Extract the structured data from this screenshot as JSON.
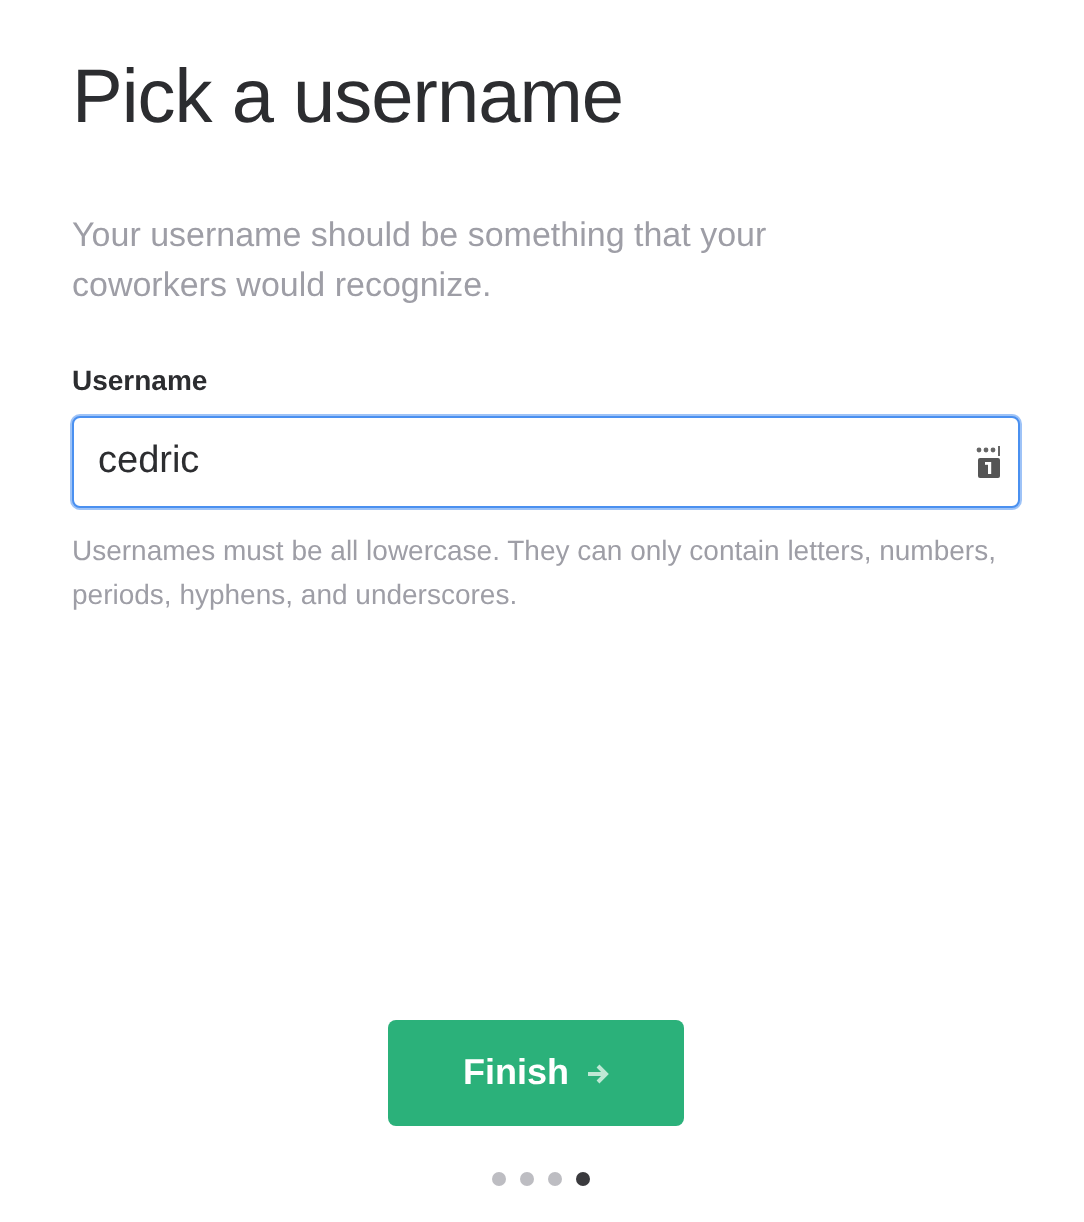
{
  "title": "Pick a username",
  "description": "Your username should be something that your coworkers would recognize.",
  "field": {
    "label": "Username",
    "value": "cedric",
    "hint": "Usernames must be all lowercase. They can only contain letters, numbers, periods, hyphens, and underscores.",
    "focused": true
  },
  "button": {
    "label": "Finish"
  },
  "steps": [
    {
      "selected": false
    },
    {
      "selected": false
    },
    {
      "selected": false
    },
    {
      "selected": true
    }
  ]
}
